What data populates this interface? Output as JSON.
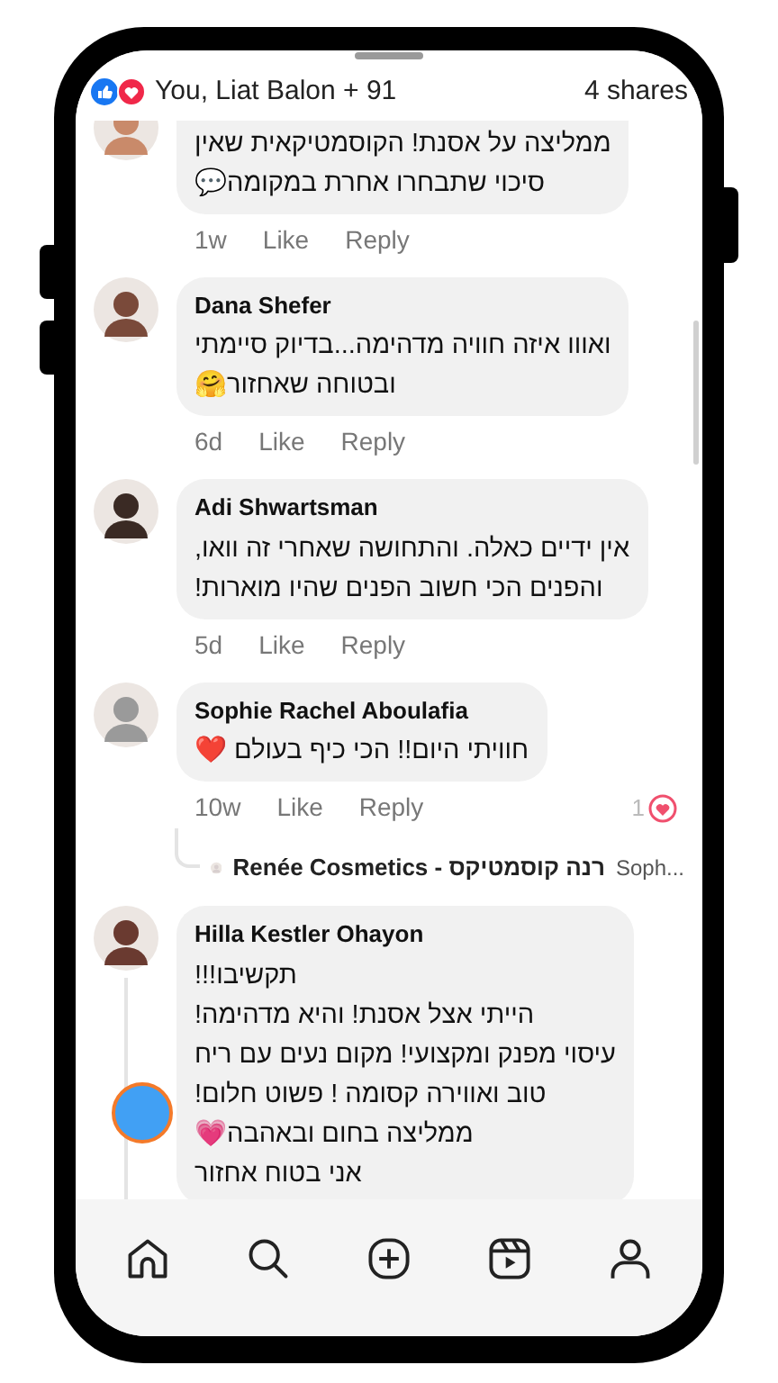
{
  "reactions": {
    "summary": "You, Liat Balon + 91",
    "shares": "4 shares"
  },
  "comments": [
    {
      "kind": "comment",
      "text": "ממליצה על אסנת! הקוסמטיקאית שאין\nסיכוי שתבחרו אחרת במקומה💬",
      "time": "1w",
      "like": "Like",
      "reply": "Reply"
    },
    {
      "kind": "comment",
      "name": "Dana Shefer",
      "text": "ואווו איזה חוויה מדהימה...בדיוק סיימתי\nובטוחה שאחזור🤗",
      "time": "6d",
      "like": "Like",
      "reply": "Reply"
    },
    {
      "kind": "comment",
      "name": "Adi Shwartsman",
      "text": "אין ידיים כאלה. והתחושה שאחרי זה וואו,\nוהפנים הכי חשוב הפנים שהיו מוארות!",
      "time": "5d",
      "like": "Like",
      "reply": "Reply"
    },
    {
      "kind": "comment",
      "name": "Sophie Rachel Aboulafia",
      "text": "חוויתי היום!! הכי כיף בעולם ❤️",
      "time": "10w",
      "like": "Like",
      "reply": "Reply",
      "reaction_count": "1"
    },
    {
      "kind": "reply_preview",
      "name": "Renée Cosmetics - רנה קוסמטיקס",
      "text": "Soph..."
    },
    {
      "kind": "comment",
      "name": "Hilla Kestler Ohayon",
      "thread": true,
      "text": "תקשיבו!!!\nהייתי אצל אסנת! והיא מדהימה!\nעיסוי מפנק ומקצועי! מקום נעים עם ריח\nטוב ואווירה קסומה ! פשוט חלום!\nממליצה בחום ובאהבה💗\nאני בטוח אחזור"
    }
  ]
}
